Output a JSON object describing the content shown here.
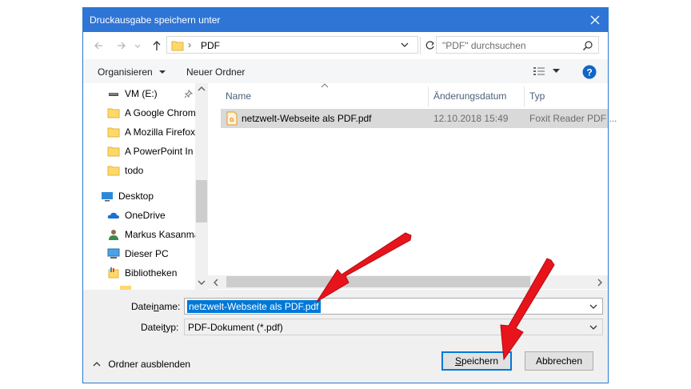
{
  "window": {
    "title": "Druckausgabe speichern unter"
  },
  "address": {
    "path": "PDF",
    "separator": "›"
  },
  "search": {
    "placeholder": "\"PDF\" durchsuchen"
  },
  "toolbar": {
    "organize_label": "Organisieren",
    "new_folder_label": "Neuer Ordner"
  },
  "sidebar": {
    "items": [
      {
        "label": "VM (E:)",
        "icon": "drive-icon"
      },
      {
        "label": "A Google Chrom",
        "icon": "folder-icon"
      },
      {
        "label": "A Mozilla Firefox",
        "icon": "folder-icon"
      },
      {
        "label": "A PowerPoint In",
        "icon": "folder-icon"
      },
      {
        "label": "todo",
        "icon": "folder-icon"
      },
      {
        "label": "Desktop",
        "icon": "desktop-icon"
      },
      {
        "label": "OneDrive",
        "icon": "cloud-icon"
      },
      {
        "label": "Markus Kasanma",
        "icon": "user-icon"
      },
      {
        "label": "Dieser PC",
        "icon": "computer-icon"
      },
      {
        "label": "Bibliotheken",
        "icon": "library-icon"
      }
    ]
  },
  "columns": {
    "name": "Name",
    "date": "Änderungsdatum",
    "type": "Typ"
  },
  "files": [
    {
      "name": "netzwelt-Webseite als PDF.pdf",
      "date": "12.10.2018 15:49",
      "type": "Foxit Reader PDF ..."
    }
  ],
  "form": {
    "filename_label_pre": "Datei",
    "filename_label_u": "n",
    "filename_label_post": "ame:",
    "filename_value": "netzwelt-Webseite als PDF.pdf",
    "filetype_label_pre": "Datei",
    "filetype_label_u": "t",
    "filetype_label_post": "yp:",
    "filetype_value": "PDF-Dokument (*.pdf)"
  },
  "buttons": {
    "save_u": "S",
    "save_rest": "peichern",
    "cancel": "Abbrechen",
    "hide_folders": "Ordner ausblenden"
  },
  "colors": {
    "titlebar": "#2f75d6",
    "selection": "#0078d7",
    "annotation_arrow": "#e8141b"
  }
}
